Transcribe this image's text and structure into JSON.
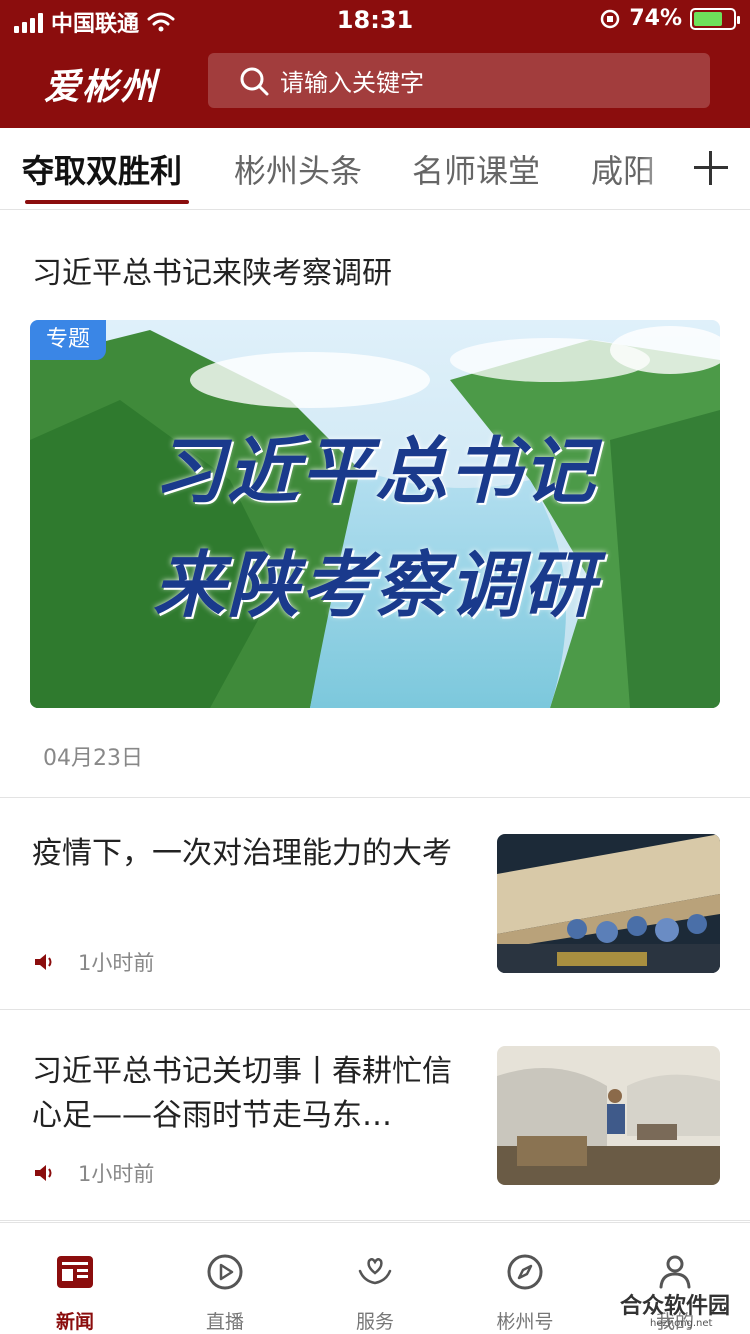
{
  "status_bar": {
    "carrier": "中国联通",
    "time": "18:31",
    "battery": "74%",
    "battery_level": 0.74
  },
  "header": {
    "logo_text": "爱彬州",
    "search_placeholder": "请输入关键字",
    "background_color": "#8b0d0d"
  },
  "channel_tabs": [
    {
      "label": "夺取双胜利",
      "active": true
    },
    {
      "label": "彬州头条",
      "active": false
    },
    {
      "label": "名师课堂",
      "active": false
    },
    {
      "label": "咸阳",
      "active": false
    }
  ],
  "featured": {
    "title": "习近平总书记来陕考察调研",
    "badge": "专题",
    "banner_line1": "习近平总书记",
    "banner_line2": "来陕考察调研",
    "date": "04月23日"
  },
  "news": [
    {
      "title": "疫情下，一次对治理能力的大考",
      "time": "1小时前",
      "thumb_icon": "airplane-crew-image"
    },
    {
      "title": "习近平总书记关切事丨春耕忙信心足——谷雨时节走马东…",
      "time": "1小时前",
      "thumb_icon": "farm-greenhouse-image"
    }
  ],
  "bottom_tabs": [
    {
      "label": "新闻",
      "icon": "news-icon",
      "active": true
    },
    {
      "label": "直播",
      "icon": "play-icon",
      "active": false
    },
    {
      "label": "服务",
      "icon": "service-heart-icon",
      "active": false
    },
    {
      "label": "彬州号",
      "icon": "compass-icon",
      "active": false
    },
    {
      "label": "我的",
      "icon": "user-icon",
      "active": false
    }
  ],
  "watermark": {
    "text": "合众软件园",
    "sub": "hezhong.net"
  }
}
